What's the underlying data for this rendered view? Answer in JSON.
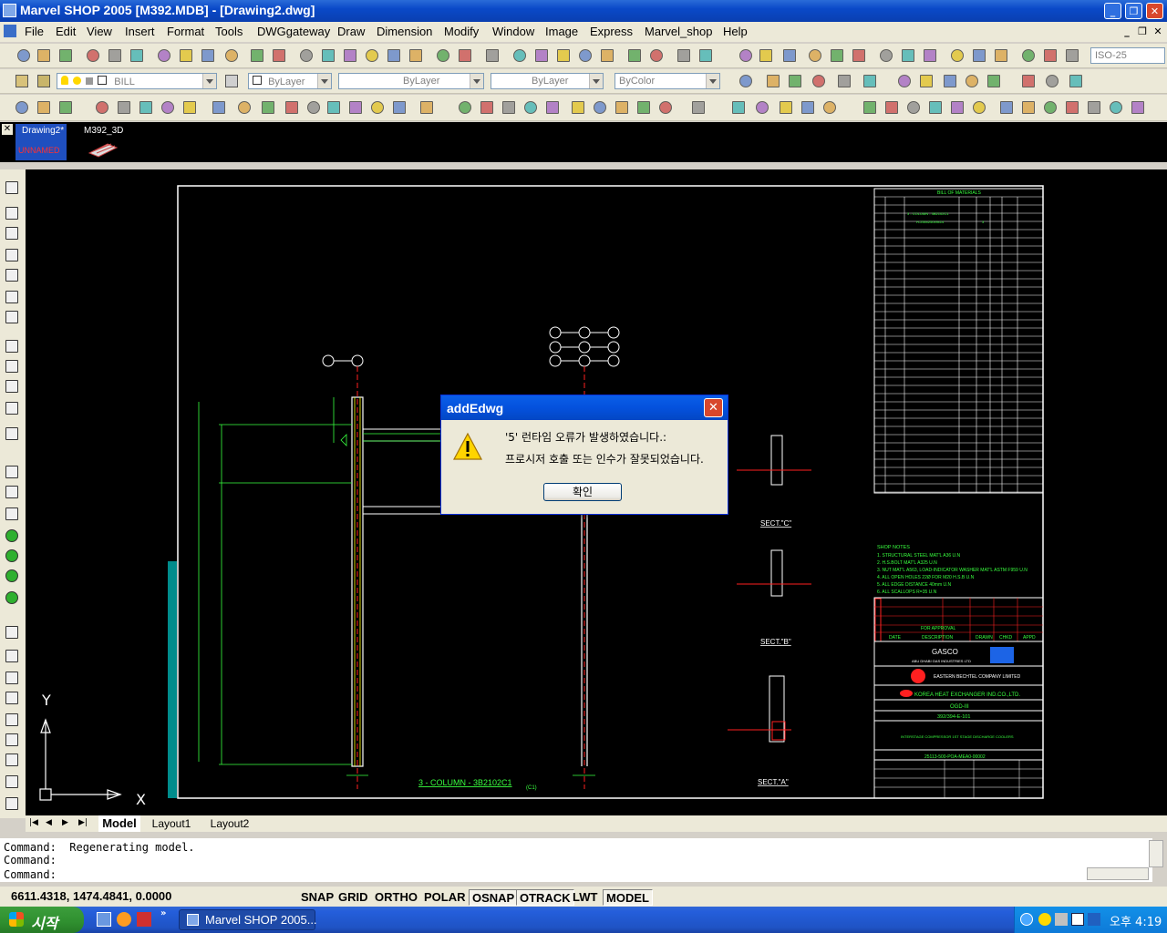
{
  "window": {
    "title": "Marvel SHOP 2005 [M392.MDB] - [Drawing2.dwg]",
    "minimize": "_",
    "restore": "❐",
    "close": "✕"
  },
  "menu": [
    {
      "label": "File"
    },
    {
      "label": "Edit"
    },
    {
      "label": "View"
    },
    {
      "label": "Insert"
    },
    {
      "label": "Format"
    },
    {
      "label": "Tools"
    },
    {
      "label": "DWGgateway"
    },
    {
      "label": "Draw"
    },
    {
      "label": "Dimension"
    },
    {
      "label": "Modify"
    },
    {
      "label": "Window"
    },
    {
      "label": "Image"
    },
    {
      "label": "Express"
    },
    {
      "label": "Marvel_shop"
    },
    {
      "label": "Help"
    }
  ],
  "toolbar": {
    "dimstyle": "ISO-25",
    "layer": "BILL",
    "color": "ByLayer",
    "linetype": "ByLayer",
    "lineweight": "ByLayer",
    "plotstyle": "ByColor"
  },
  "doc_tabs": [
    {
      "label": "Drawing2*",
      "sub": "UNNAMED"
    },
    {
      "label": "M392_3D"
    }
  ],
  "layout_tabs": [
    "Model",
    "Layout1",
    "Layout2"
  ],
  "ucs": {
    "x": "X",
    "y": "Y"
  },
  "drawing": {
    "bom_title": "BILL OF MATERIALS",
    "bom_row1": "3 - COLUMN - 3B2102C1",
    "bom_row2": "H-250x250x9x14",
    "bom_qty": "3",
    "shop_notes_title": "SHOP NOTES",
    "shop_notes": [
      "1. STRUCTURAL STEEL MAT'L A36 U.N",
      "2. H.S.BOLT MAT'L A325 U.N",
      "3. NUT MAT'L A563, LOAD-INDICATOR WASHER MAT'L ASTM F959 U.N",
      "4. ALL OPEN HOLES 22Ø FOR M20 H.S.B U.N",
      "5. ALL EDGE DISTANCE 40mm U.N",
      "6. ALL SCALLOPS R=35 U.N"
    ],
    "sect_c": "SECT.\"C\"",
    "sect_b": "SECT.\"B\"",
    "sect_a": "SECT.\"A\"",
    "column_label": "3 - COLUMN - 3B2102C1",
    "column_qty": "(C1)",
    "rev_for_approval": "FOR APPROVAL",
    "rev_date": "DATE",
    "rev_description": "DESCRIPTION",
    "rev_drawn": "DRAWN",
    "rev_chkd": "CHKD",
    "rev_appd": "APPD",
    "client": "GASCO",
    "client_sub": "ABU DHABI GAS INDUSTRIES LTD",
    "contractor": "EASTERN BECHTEL COMPANY LIMITED",
    "manufacturer": "KOREA HEAT EXCHANGER IND.CO.,LTD.",
    "project": "OGD-III",
    "tag_no": "392/394-E-101",
    "service": "INTERSTAGE COMPRESSOR 1ST STAGE DISCHARGE COOLERS",
    "po_no": "25113-500-POA-MEA0-00002"
  },
  "dialog": {
    "title": "addEdwg",
    "line1": "'5' 런타임 오류가 발생하였습니다.:",
    "line2": "프로시저 호출 또는 인수가 잘못되었습니다.",
    "ok": "확인"
  },
  "command": {
    "line1": "Command:  Regenerating model.",
    "line2": "Command:",
    "line3": "Command:"
  },
  "status": {
    "coords": "6611.4318, 1474.4841, 0.0000",
    "snap": "SNAP",
    "grid": "GRID",
    "ortho": "ORTHO",
    "polar": "POLAR",
    "osnap": "OSNAP",
    "otrack": "OTRACK",
    "lwt": "LWT",
    "model": "MODEL"
  },
  "taskbar": {
    "start": "시작",
    "task": "Marvel SHOP 2005...",
    "clock": "오후 4:19"
  },
  "colors": {
    "cad_green": "#39ff3f",
    "cad_red": "#ff2020",
    "cad_yellow": "#ffff00",
    "cad_white": "#ffffff",
    "cad_cyan": "#00ffff"
  }
}
